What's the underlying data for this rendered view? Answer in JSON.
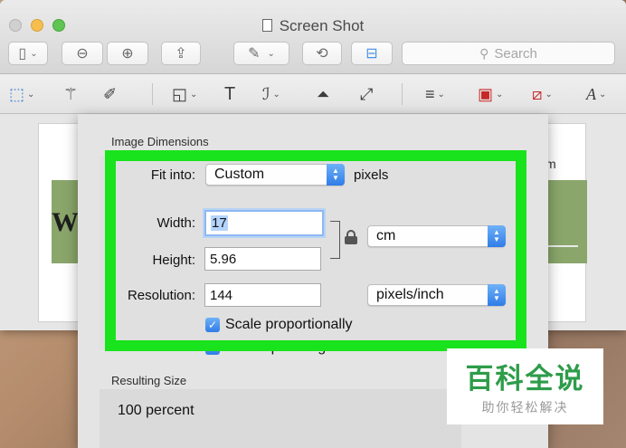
{
  "window": {
    "title": "Screen Shot"
  },
  "toolbar": {
    "search_placeholder": "Search"
  },
  "document_preview": {
    "left_fragment": "W",
    "right_fragment": "m"
  },
  "sheet": {
    "image_dimensions_label": "Image Dimensions",
    "fit_into_label": "Fit into:",
    "fit_into_value": "Custom",
    "fit_into_unit": "pixels",
    "width_label": "Width:",
    "width_value": "17",
    "height_label": "Height:",
    "height_value": "5.96",
    "size_unit_value": "cm",
    "resolution_label": "Resolution:",
    "resolution_value": "144",
    "resolution_unit_value": "pixels/inch",
    "scale_label": "Scale proportionally",
    "scale_checked": true,
    "resample_label": "Resample image",
    "resample_checked": true,
    "resulting_size_label": "Resulting Size",
    "resulting_size_value": "100 percent"
  },
  "watermark": {
    "main": "百科全说",
    "sub": "助你轻松解决"
  },
  "colors": {
    "highlight_frame": "#19e31d",
    "accent_blue": "#2f7ce8",
    "watermark_green": "#2e9c4a"
  }
}
